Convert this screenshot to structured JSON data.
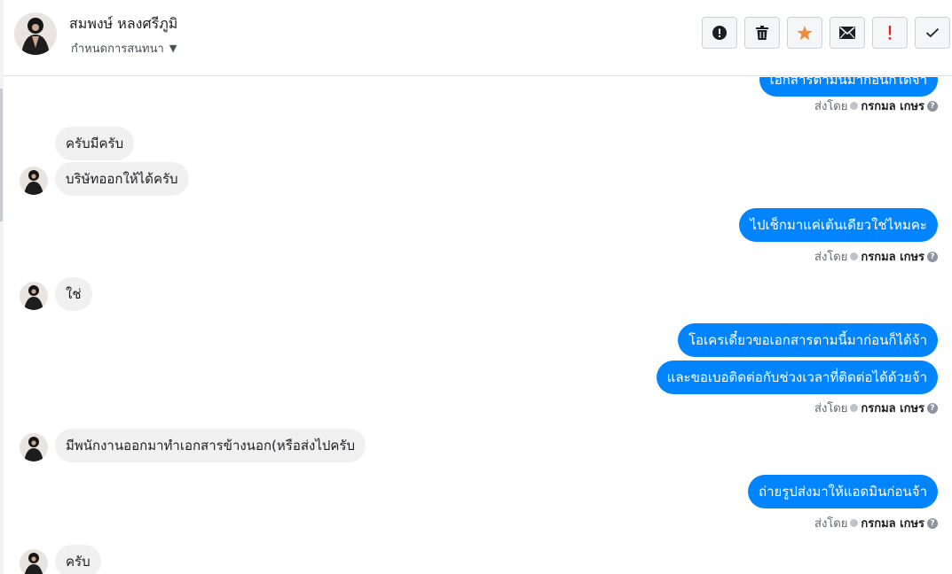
{
  "header": {
    "contact_name": "สมพงษ์ หลงศรีภูมิ",
    "assign_label": "กำหนดการสนทนา"
  },
  "toolbar": {
    "buttons": [
      {
        "name": "spam",
        "icon": "exclamation-circle-icon"
      },
      {
        "name": "delete",
        "icon": "trash-icon"
      },
      {
        "name": "star",
        "icon": "star-icon",
        "color": "#f28c38"
      },
      {
        "name": "unread",
        "icon": "envelope-icon"
      },
      {
        "name": "follow-up",
        "icon": "exclamation-icon",
        "color": "#e02424"
      },
      {
        "name": "done",
        "icon": "checkmark-icon"
      }
    ]
  },
  "colors": {
    "outgoing_bubble": "#0084ff",
    "incoming_bubble": "#f1f0f0",
    "star": "#f28c38",
    "follow_up": "#e02424"
  },
  "messages": {
    "m0": "เอกสารตามนี้มาก่อนก็ได้จ้า",
    "meta0": {
      "sent_by": "ส่งโดย",
      "agent": "กรกมล เกษร"
    },
    "m1": "ครับมีครับ",
    "m2": "บริษัทออกให้ได้ครับ",
    "m3": "ไปเช็กมาแค่เต้นเดียวใช่ไหมคะ",
    "meta3": {
      "sent_by": "ส่งโดย",
      "agent": "กรกมล เกษร"
    },
    "m4": "ใช่",
    "m5": "โอเครเดี๋ยวขอเอกสารตามนี้มาก่อนก็ได้จ้า",
    "m6": "และขอเบอติดต่อกับช่วงเวลาที่ติดต่อได้ด้วยจ้า",
    "meta6": {
      "sent_by": "ส่งโดย",
      "agent": "กรกมล เกษร"
    },
    "m7": "มีพนักงานออกมาทำเอกสารข้างนอก(หรือส่งไปครับ",
    "m8": "ถ่ายรูปส่งมาให้แอดมินก่อนจ้า",
    "meta8": {
      "sent_by": "ส่งโดย",
      "agent": "กรกมล เกษร"
    },
    "m9": "ครับ"
  }
}
